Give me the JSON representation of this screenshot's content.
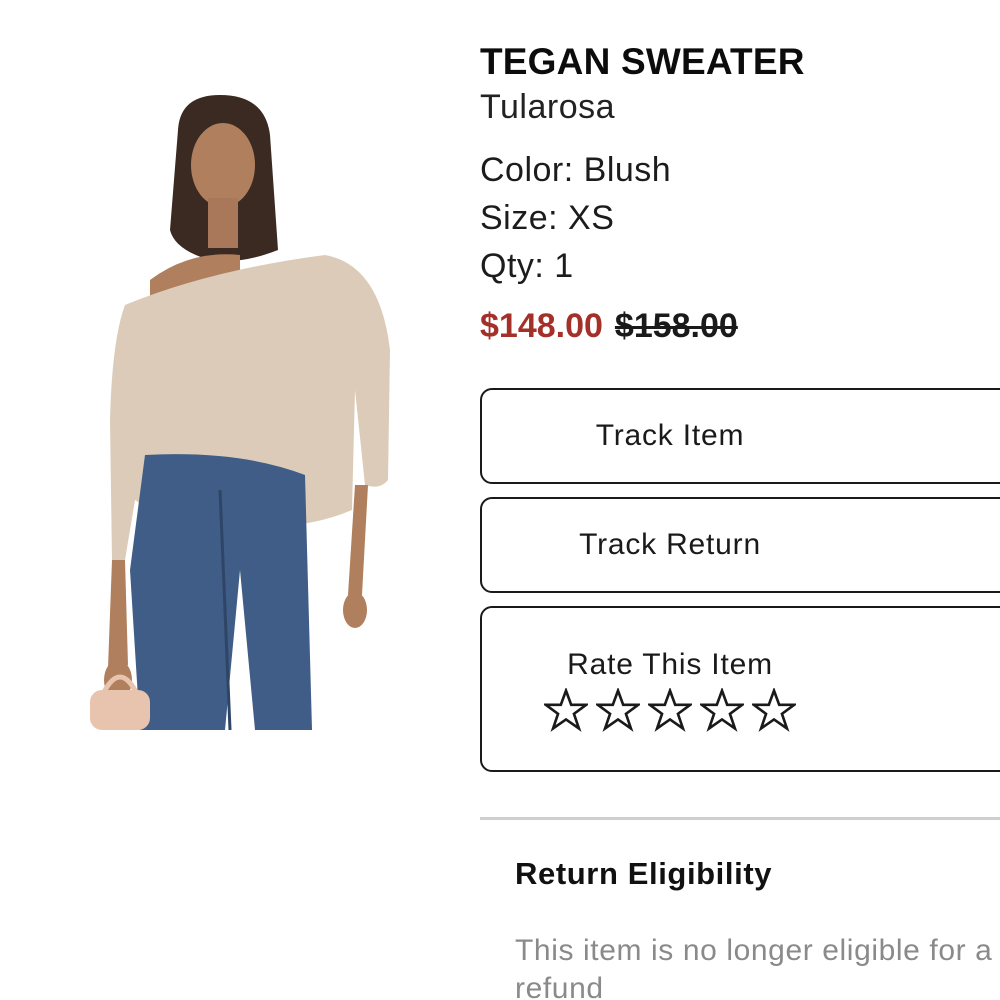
{
  "product": {
    "name": "TEGAN SWEATER",
    "brand": "Tularosa",
    "color_label": "Color: Blush",
    "size_label": "Size: XS",
    "qty_label": "Qty: 1",
    "sale_price": "$148.00",
    "original_price": "$158.00"
  },
  "actions": {
    "track_item": "Track Item",
    "track_return": "Track Return",
    "rate_label": "Rate This Item",
    "rating_filled": 0,
    "rating_max": 5
  },
  "returns": {
    "title": "Return Eligibility",
    "message": "This item is no longer eligible for a refund"
  },
  "colors": {
    "sale_price": "#a4302a",
    "text": "#1a1a1a",
    "muted": "#8a8a8a",
    "divider": "#cfcfcf"
  },
  "icons": {
    "star": "star-outline-icon"
  }
}
